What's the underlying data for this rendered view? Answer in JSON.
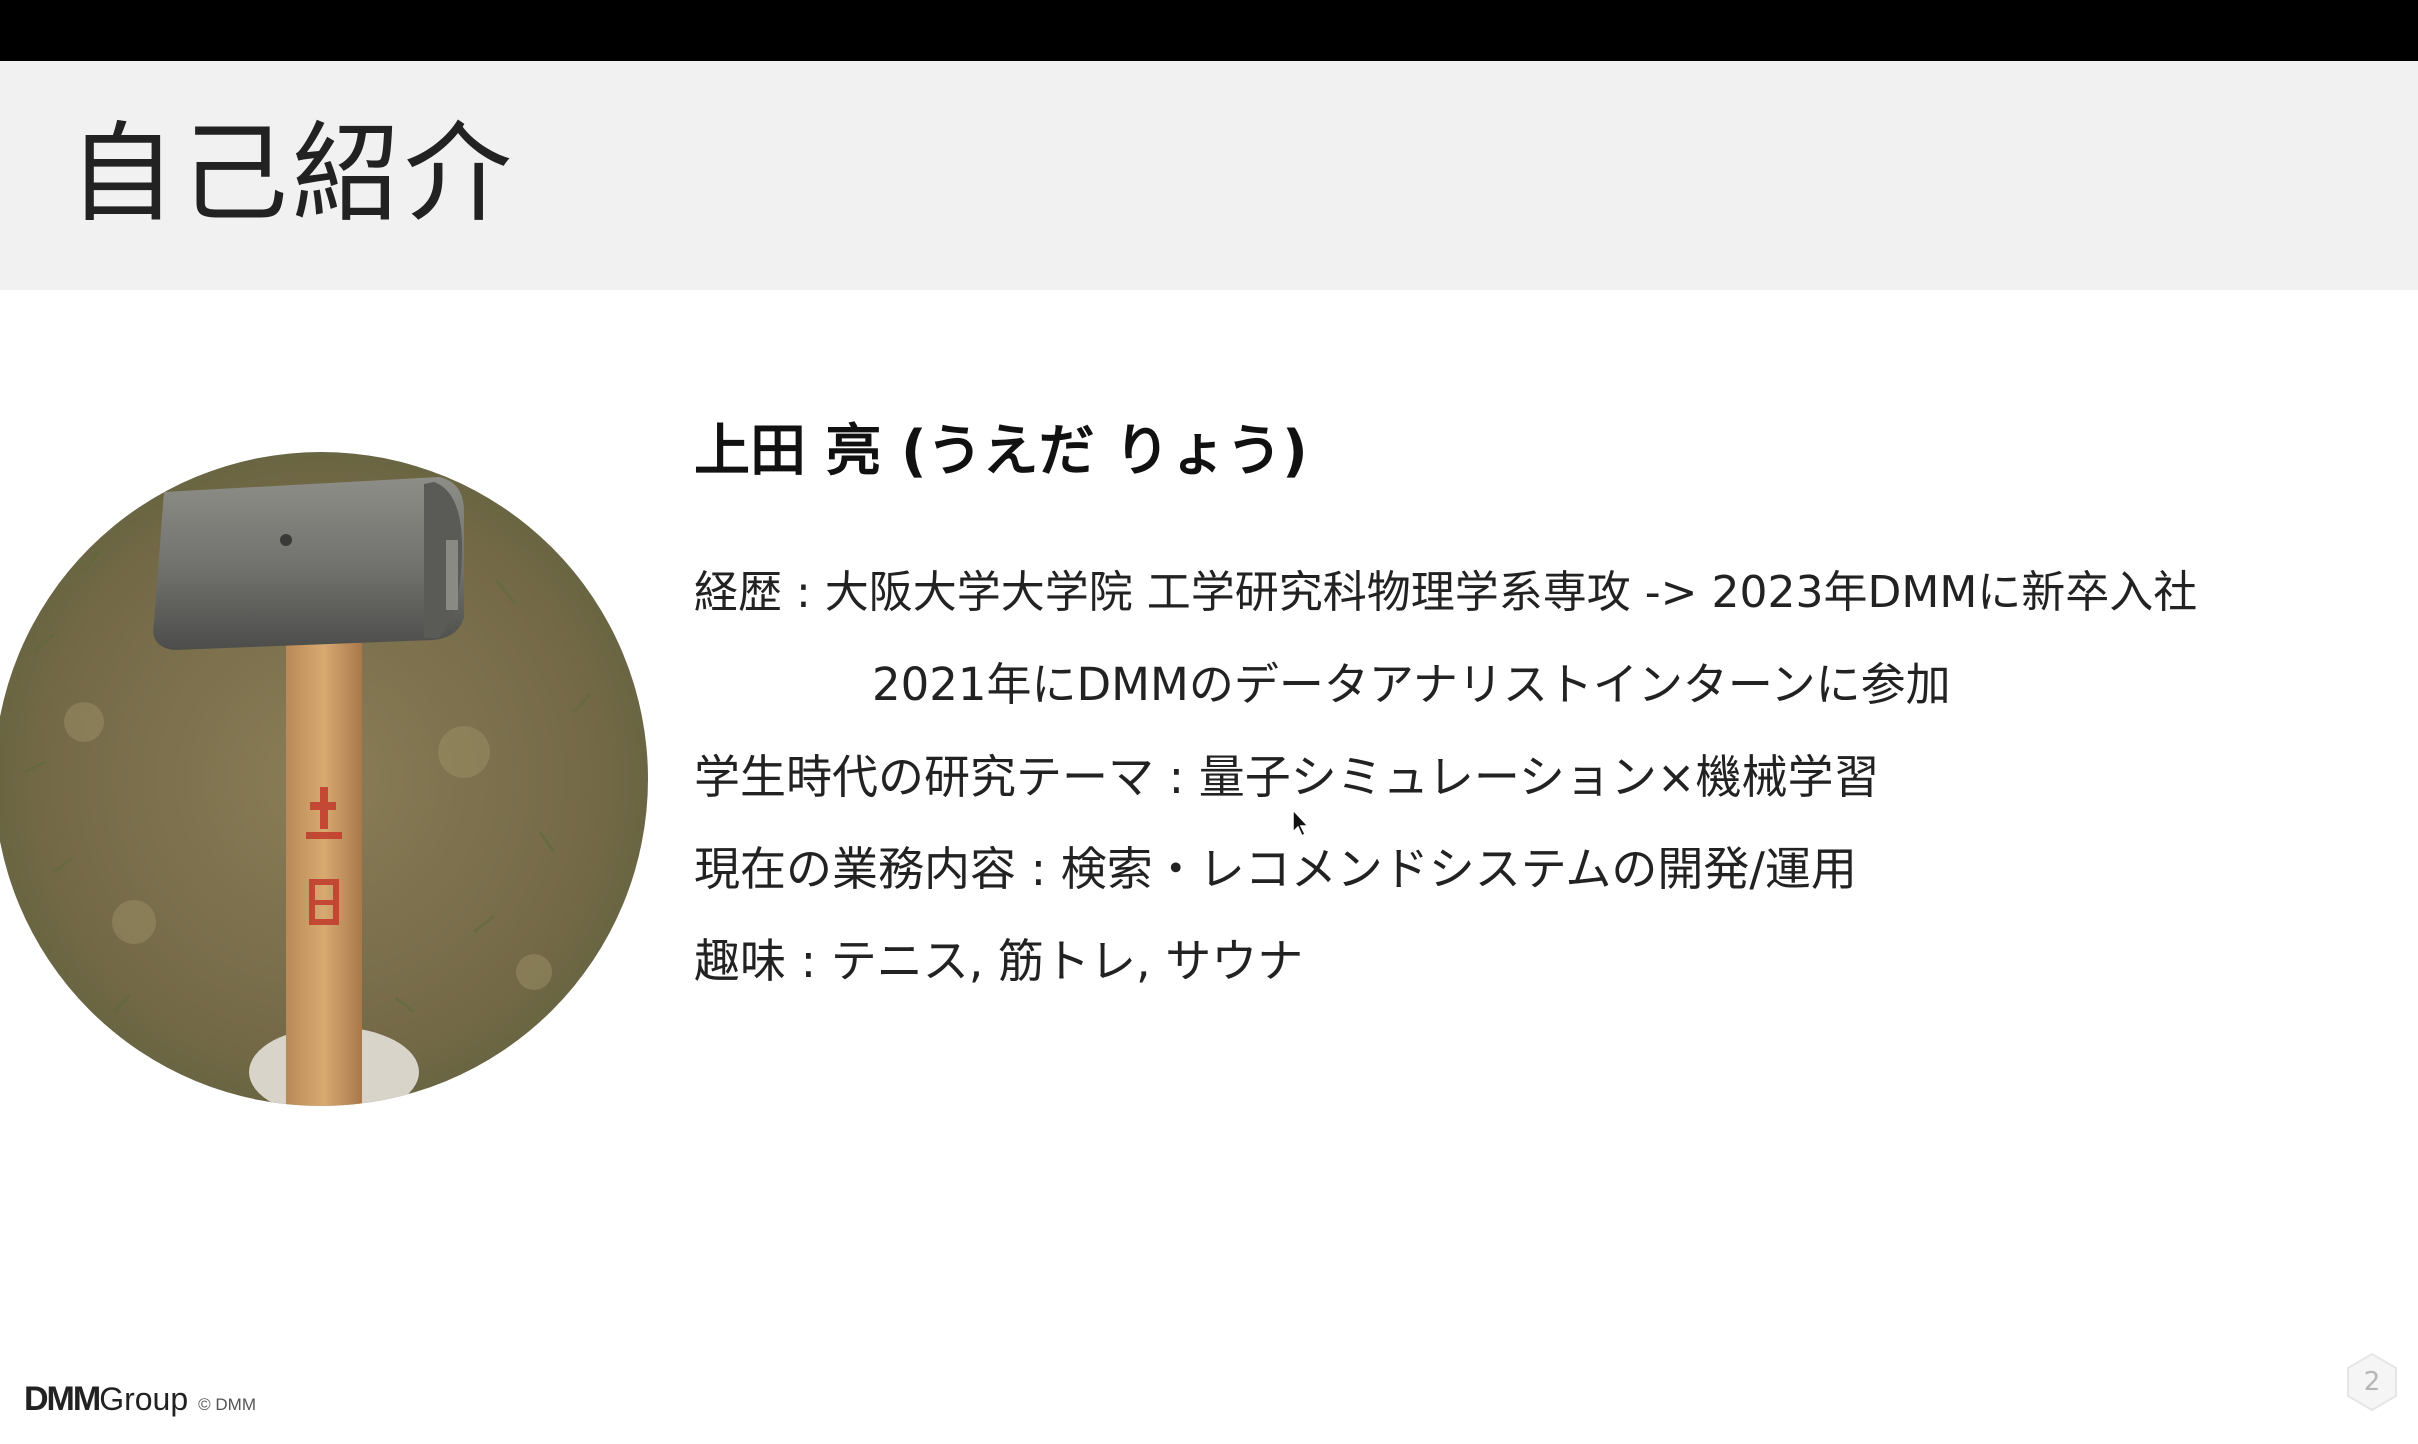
{
  "slide": {
    "title": "自己紹介",
    "page_number": "2"
  },
  "profile": {
    "name": "上田 亮 (うえだ りょう)",
    "lines": [
      "経歴 : 大阪大学大学院 工学研究科物理学系専攻 -> 2023年DMMに新卒入社",
      "2021年にDMMのデータアナリストインターンに参加",
      "学生時代の研究テーマ : 量子シミュレーション×機械学習",
      "現在の業務内容 : 検索・レコメンドシステムの開発/運用",
      "趣味 : テニス, 筋トレ, サウナ"
    ],
    "photo_icon": "mallet-photo"
  },
  "footer": {
    "brand": "DMM",
    "group": "Group",
    "copyright": "© DMM"
  },
  "colors": {
    "top_bar": "#000000",
    "title_band": "#f1f1f1",
    "text": "#222222"
  }
}
